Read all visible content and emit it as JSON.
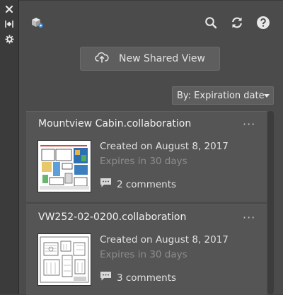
{
  "side_strip": {
    "close_icon": "close-icon",
    "collapse_icon": "collapse-icon",
    "settings_icon": "settings-icon"
  },
  "toolbar": {
    "logo_icon": "collaboration-logo-icon",
    "search_icon": "search-icon",
    "refresh_icon": "refresh-icon",
    "help_icon": "help-icon"
  },
  "share_button": {
    "label": "New Shared View",
    "icon": "cloud-upload-icon"
  },
  "sort": {
    "label": "By: Expiration date"
  },
  "colors": {
    "panel_bg": "#4b4b4b",
    "card_bg": "#555555",
    "muted_text": "#8d8d8d"
  },
  "views": [
    {
      "title": "Mountview Cabin.collaboration",
      "created": "Created on August 8, 2017",
      "expires": "Expires in 30 days",
      "comments": "2 comments",
      "menu": "···"
    },
    {
      "title": "VW252-02-0200.collaboration",
      "created": "Created on August 8, 2017",
      "expires": "Expires in 30 days",
      "comments": "3 comments",
      "menu": "···"
    }
  ]
}
